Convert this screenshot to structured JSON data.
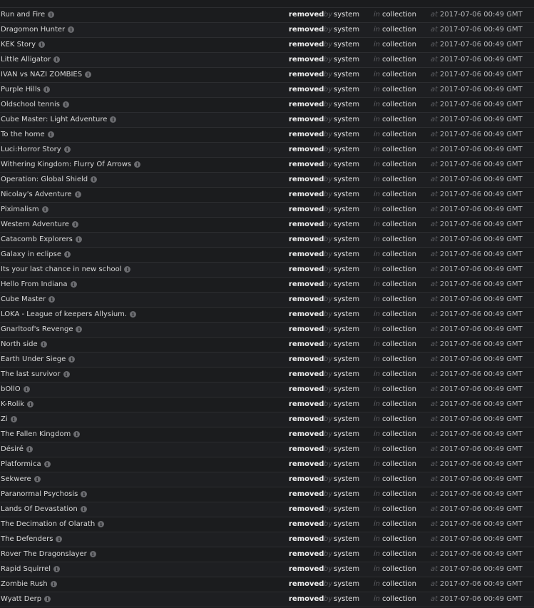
{
  "labels": {
    "by": "by",
    "in": "in",
    "at": "at"
  },
  "entries": [
    {
      "title": "Run and Fire",
      "action": "removed",
      "actor": "system",
      "target": "collection",
      "timestamp": "2017-07-06 00:49 GMT"
    },
    {
      "title": "Dragomon Hunter",
      "action": "removed",
      "actor": "system",
      "target": "collection",
      "timestamp": "2017-07-06 00:49 GMT"
    },
    {
      "title": "KEK Story",
      "action": "removed",
      "actor": "system",
      "target": "collection",
      "timestamp": "2017-07-06 00:49 GMT"
    },
    {
      "title": "Little Alligator",
      "action": "removed",
      "actor": "system",
      "target": "collection",
      "timestamp": "2017-07-06 00:49 GMT"
    },
    {
      "title": "IVAN vs NAZI ZOMBIES",
      "action": "removed",
      "actor": "system",
      "target": "collection",
      "timestamp": "2017-07-06 00:49 GMT"
    },
    {
      "title": "Purple Hills",
      "action": "removed",
      "actor": "system",
      "target": "collection",
      "timestamp": "2017-07-06 00:49 GMT"
    },
    {
      "title": "Oldschool tennis",
      "action": "removed",
      "actor": "system",
      "target": "collection",
      "timestamp": "2017-07-06 00:49 GMT"
    },
    {
      "title": "Cube Master: Light Adventure",
      "action": "removed",
      "actor": "system",
      "target": "collection",
      "timestamp": "2017-07-06 00:49 GMT"
    },
    {
      "title": "To the home",
      "action": "removed",
      "actor": "system",
      "target": "collection",
      "timestamp": "2017-07-06 00:49 GMT"
    },
    {
      "title": "Luci:Horror Story",
      "action": "removed",
      "actor": "system",
      "target": "collection",
      "timestamp": "2017-07-06 00:49 GMT"
    },
    {
      "title": "Withering Kingdom: Flurry Of Arrows",
      "action": "removed",
      "actor": "system",
      "target": "collection",
      "timestamp": "2017-07-06 00:49 GMT"
    },
    {
      "title": "Operation: Global Shield",
      "action": "removed",
      "actor": "system",
      "target": "collection",
      "timestamp": "2017-07-06 00:49 GMT"
    },
    {
      "title": "Nicolay's Adventure",
      "action": "removed",
      "actor": "system",
      "target": "collection",
      "timestamp": "2017-07-06 00:49 GMT"
    },
    {
      "title": "Piximalism",
      "action": "removed",
      "actor": "system",
      "target": "collection",
      "timestamp": "2017-07-06 00:49 GMT"
    },
    {
      "title": "Western Adventure",
      "action": "removed",
      "actor": "system",
      "target": "collection",
      "timestamp": "2017-07-06 00:49 GMT"
    },
    {
      "title": "Catacomb Explorers",
      "action": "removed",
      "actor": "system",
      "target": "collection",
      "timestamp": "2017-07-06 00:49 GMT"
    },
    {
      "title": "Galaxy in eclipse",
      "action": "removed",
      "actor": "system",
      "target": "collection",
      "timestamp": "2017-07-06 00:49 GMT"
    },
    {
      "title": "Its your last chance in new school",
      "action": "removed",
      "actor": "system",
      "target": "collection",
      "timestamp": "2017-07-06 00:49 GMT"
    },
    {
      "title": "Hello From Indiana",
      "action": "removed",
      "actor": "system",
      "target": "collection",
      "timestamp": "2017-07-06 00:49 GMT"
    },
    {
      "title": "Cube Master",
      "action": "removed",
      "actor": "system",
      "target": "collection",
      "timestamp": "2017-07-06 00:49 GMT"
    },
    {
      "title": "LOKA - League of keepers Allysium.",
      "action": "removed",
      "actor": "system",
      "target": "collection",
      "timestamp": "2017-07-06 00:49 GMT"
    },
    {
      "title": "Gnarltoof's Revenge",
      "action": "removed",
      "actor": "system",
      "target": "collection",
      "timestamp": "2017-07-06 00:49 GMT"
    },
    {
      "title": "North side",
      "action": "removed",
      "actor": "system",
      "target": "collection",
      "timestamp": "2017-07-06 00:49 GMT"
    },
    {
      "title": "Earth Under Siege",
      "action": "removed",
      "actor": "system",
      "target": "collection",
      "timestamp": "2017-07-06 00:49 GMT"
    },
    {
      "title": "The last survivor",
      "action": "removed",
      "actor": "system",
      "target": "collection",
      "timestamp": "2017-07-06 00:49 GMT"
    },
    {
      "title": "bOllO",
      "action": "removed",
      "actor": "system",
      "target": "collection",
      "timestamp": "2017-07-06 00:49 GMT"
    },
    {
      "title": "K-Rolik",
      "action": "removed",
      "actor": "system",
      "target": "collection",
      "timestamp": "2017-07-06 00:49 GMT"
    },
    {
      "title": "Zi",
      "action": "removed",
      "actor": "system",
      "target": "collection",
      "timestamp": "2017-07-06 00:49 GMT"
    },
    {
      "title": "The Fallen Kingdom",
      "action": "removed",
      "actor": "system",
      "target": "collection",
      "timestamp": "2017-07-06 00:49 GMT"
    },
    {
      "title": "Désiré",
      "action": "removed",
      "actor": "system",
      "target": "collection",
      "timestamp": "2017-07-06 00:49 GMT"
    },
    {
      "title": "Platformica",
      "action": "removed",
      "actor": "system",
      "target": "collection",
      "timestamp": "2017-07-06 00:49 GMT"
    },
    {
      "title": "Sekwere",
      "action": "removed",
      "actor": "system",
      "target": "collection",
      "timestamp": "2017-07-06 00:49 GMT"
    },
    {
      "title": "Paranormal Psychosis",
      "action": "removed",
      "actor": "system",
      "target": "collection",
      "timestamp": "2017-07-06 00:49 GMT"
    },
    {
      "title": "Lands Of Devastation",
      "action": "removed",
      "actor": "system",
      "target": "collection",
      "timestamp": "2017-07-06 00:49 GMT"
    },
    {
      "title": "The Decimation of Olarath",
      "action": "removed",
      "actor": "system",
      "target": "collection",
      "timestamp": "2017-07-06 00:49 GMT"
    },
    {
      "title": "The Defenders",
      "action": "removed",
      "actor": "system",
      "target": "collection",
      "timestamp": "2017-07-06 00:49 GMT"
    },
    {
      "title": "Rover The Dragonslayer",
      "action": "removed",
      "actor": "system",
      "target": "collection",
      "timestamp": "2017-07-06 00:49 GMT"
    },
    {
      "title": "Rapid Squirrel",
      "action": "removed",
      "actor": "system",
      "target": "collection",
      "timestamp": "2017-07-06 00:49 GMT"
    },
    {
      "title": "Zombie Rush",
      "action": "removed",
      "actor": "system",
      "target": "collection",
      "timestamp": "2017-07-06 00:49 GMT"
    },
    {
      "title": "Wyatt Derp",
      "action": "removed",
      "actor": "system",
      "target": "collection",
      "timestamp": "2017-07-06 00:49 GMT"
    }
  ]
}
